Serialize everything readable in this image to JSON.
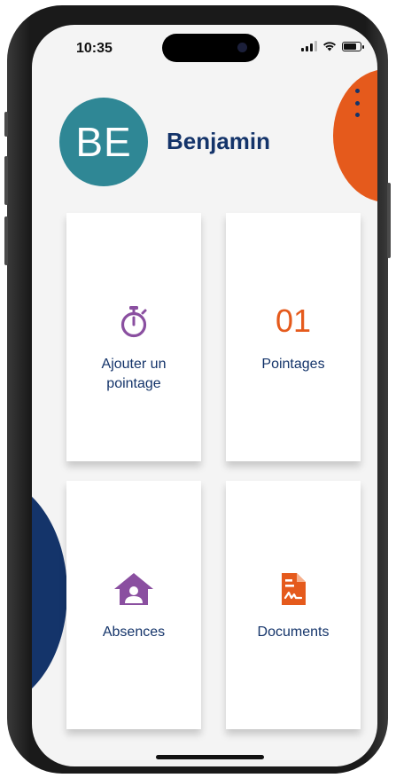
{
  "status_bar": {
    "time": "10:35"
  },
  "header": {
    "avatar_initials": "BE",
    "user_name": "Benjamin"
  },
  "cards": [
    {
      "label": "Ajouter un pointage",
      "icon": "stopwatch-icon"
    },
    {
      "label": "Pointages",
      "count": "01"
    },
    {
      "label": "Absences",
      "icon": "home-user-icon"
    },
    {
      "label": "Documents",
      "icon": "document-signature-icon"
    }
  ],
  "colors": {
    "primary_blue": "#14346a",
    "accent_orange": "#e55a1c",
    "accent_purple": "#8a4fa0",
    "avatar_teal": "#2f8795"
  }
}
